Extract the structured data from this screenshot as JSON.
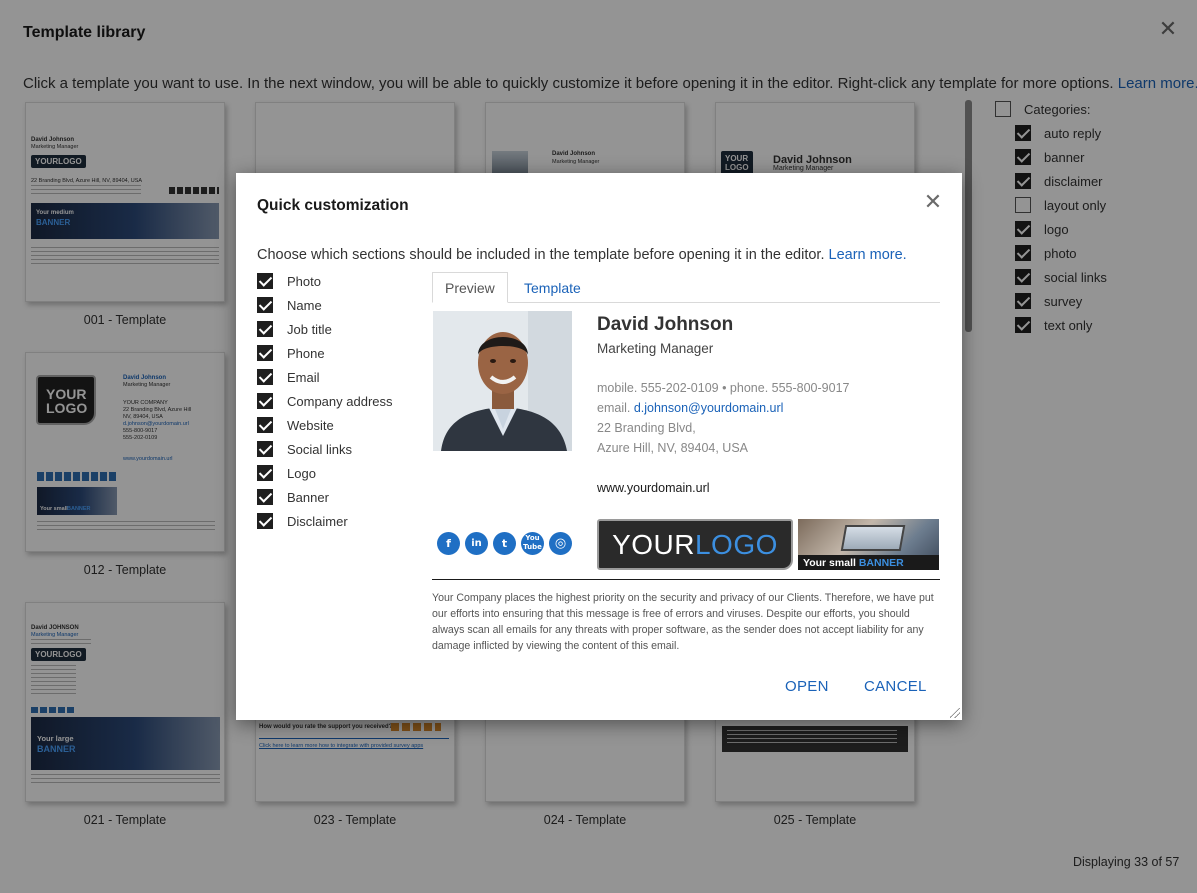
{
  "library": {
    "title": "Template library",
    "close_icon": "close-icon",
    "instructions": "Click a template you want to use. In the next window, you will be able to quickly customize it before opening it in the editor. Right-click any template for more options.",
    "learn_more": "Learn more.",
    "templates": [
      {
        "label": "001 - Template"
      },
      {
        "label": "012 - Template"
      },
      {
        "label": "021 - Template"
      },
      {
        "label": "023 - Template"
      },
      {
        "label": "024 - Template"
      },
      {
        "label": "025 - Template"
      }
    ],
    "thumbs": {
      "t001": {
        "name": "David Johnson",
        "job": "Marketing Manager",
        "logo": "YOURLOGO",
        "addr": "22 Branding Blvd, Azure Hill, NV, 89404, USA",
        "banner_a": "Your medium",
        "banner_b": "BANNER"
      },
      "t012": {
        "name": "David Johnson",
        "job": "Marketing Manager",
        "logo_a": "YOUR",
        "logo_b": "LOGO",
        "company": "YOUR COMPANY",
        "addr1": "22 Branding Blvd, Azure Hill",
        "addr2": "NV, 89404, USA",
        "email": "d.johnson@yourdomain.url",
        "phone1": "555-800-9017",
        "phone2": "555-202-0109",
        "web": "www.yourdomain.url",
        "banner_a": "Your small",
        "banner_b": "BANNER"
      },
      "t021": {
        "name": "David JOHNSON",
        "job": "Marketing Manager",
        "logo": "YOURLOGO",
        "banner_a": "Your large",
        "banner_b": "BANNER"
      },
      "t023": {
        "survey": "How would you rate the support you received?",
        "link": "Click here to learn more how to integrate with provided survey apps"
      },
      "t_top3": {
        "name": "David Johnson",
        "job": "Marketing Manager"
      },
      "t_top4": {
        "name": "David Johnson",
        "job": "Marketing Manager",
        "logo_a": "YOUR",
        "logo_b": "LOGO"
      }
    },
    "categories_label": "Categories:",
    "categories": [
      {
        "label": "auto reply",
        "checked": true
      },
      {
        "label": "banner",
        "checked": true
      },
      {
        "label": "disclaimer",
        "checked": true
      },
      {
        "label": "layout only",
        "checked": false
      },
      {
        "label": "logo",
        "checked": true
      },
      {
        "label": "photo",
        "checked": true
      },
      {
        "label": "social links",
        "checked": true
      },
      {
        "label": "survey",
        "checked": true
      },
      {
        "label": "text only",
        "checked": true
      }
    ],
    "displaying": "Displaying 33 of 57"
  },
  "dialog": {
    "title": "Quick customization",
    "close_icon": "close-icon",
    "instructions": "Choose which sections should be included in the template before opening it in the editor.",
    "learn_more": "Learn more.",
    "sections": [
      {
        "label": "Photo",
        "checked": true
      },
      {
        "label": "Name",
        "checked": true
      },
      {
        "label": "Job title",
        "checked": true
      },
      {
        "label": "Phone",
        "checked": true
      },
      {
        "label": "Email",
        "checked": true
      },
      {
        "label": "Company address",
        "checked": true
      },
      {
        "label": "Website",
        "checked": true
      },
      {
        "label": "Social links",
        "checked": true
      },
      {
        "label": "Logo",
        "checked": true
      },
      {
        "label": "Banner",
        "checked": true
      },
      {
        "label": "Disclaimer",
        "checked": true
      }
    ],
    "tabs": {
      "preview": "Preview",
      "template": "Template"
    },
    "preview": {
      "name": "David Johnson",
      "job_title": "Marketing Manager",
      "phones": "mobile. 555-202-0109 • phone. 555-800-9017",
      "email_label": "email.",
      "email": "d.johnson@yourdomain.url",
      "address1": "22 Branding Blvd,",
      "address2": "Azure Hill, NV, 89404, USA",
      "website": "www.yourdomain.url",
      "social": [
        {
          "icon": "facebook-icon",
          "glyph": "f"
        },
        {
          "icon": "linkedin-icon",
          "glyph": "in"
        },
        {
          "icon": "twitter-icon",
          "glyph": "t"
        },
        {
          "icon": "youtube-icon",
          "glyph": "You Tube"
        },
        {
          "icon": "instagram-icon",
          "glyph": "◎"
        }
      ],
      "logo_a": "YOUR",
      "logo_b": "LOGO",
      "banner_a": "Your small",
      "banner_b": "BANNER",
      "disclaimer": "Your Company places the highest priority on the security and privacy of our Clients. Therefore, we have put our efforts into ensuring that this message is free of errors and viruses. Despite our efforts, you should always scan all emails for any threats with proper software, as the sender does not accept liability for any damage inflicted by viewing the content of this email."
    },
    "open_button": "OPEN",
    "cancel_button": "CANCEL"
  },
  "colors": {
    "link": "#1a62b8",
    "social": "#1f6fc4",
    "overlay": "rgba(0,0,0,0.42)"
  }
}
